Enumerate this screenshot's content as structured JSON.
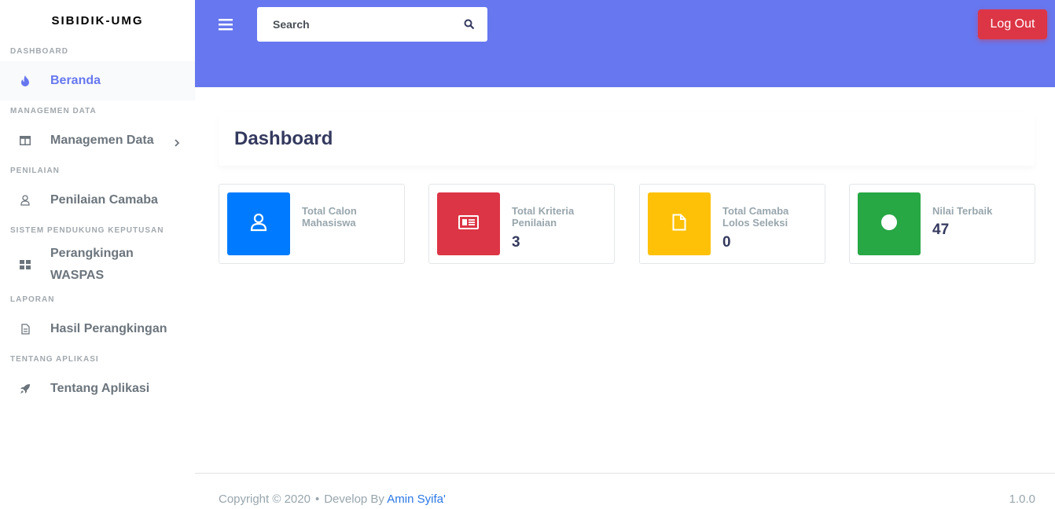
{
  "brand": "SIBIDIK-UMG",
  "sidebar": {
    "sections": [
      {
        "header": "DASHBOARD",
        "items": [
          {
            "label": "Beranda",
            "icon": "fire-icon",
            "active": true
          }
        ]
      },
      {
        "header": "MANAGEMEN DATA",
        "items": [
          {
            "label": "Managemen Data",
            "icon": "columns-icon",
            "has_submenu": true
          }
        ]
      },
      {
        "header": "PENILAIAN",
        "items": [
          {
            "label": "Penilaian Camaba",
            "icon": "user-icon"
          }
        ]
      },
      {
        "header": "SISTEM PENDUKUNG KEPUTUSAN",
        "items": [
          {
            "label": "Perangkingan WASPAS",
            "icon": "th-large-icon"
          }
        ]
      },
      {
        "header": "LAPORAN",
        "items": [
          {
            "label": "Hasil Perangkingan",
            "icon": "file-icon"
          }
        ]
      },
      {
        "header": "TENTANG APLIKASI",
        "items": [
          {
            "label": "Tentang Aplikasi",
            "icon": "rocket-icon"
          }
        ]
      }
    ]
  },
  "topbar": {
    "search_placeholder": "Search",
    "logout_label": "Log Out"
  },
  "page": {
    "title": "Dashboard"
  },
  "stats": [
    {
      "label": "Total Calon Mahasiswa",
      "value": "",
      "color": "#007bff",
      "icon": "user-icon"
    },
    {
      "label": "Total Kriteria Penilaian",
      "value": "3",
      "color": "#dc3545",
      "icon": "newspaper-icon"
    },
    {
      "label": "Total Camaba Lolos Seleksi",
      "value": "0",
      "color": "#ffc107",
      "icon": "file-icon"
    },
    {
      "label": "Nilai Terbaik",
      "value": "47",
      "color": "#28a745",
      "icon": "circle-icon"
    }
  ],
  "footer": {
    "copyright": "Copyright © 2020",
    "separator": "•",
    "develop_by": "Develop By",
    "author": "Amin Syifa'",
    "version": "1.0.0"
  },
  "colors": {
    "primary": "#6777ef",
    "danger": "#dc3545",
    "link": "#2a77e6"
  }
}
